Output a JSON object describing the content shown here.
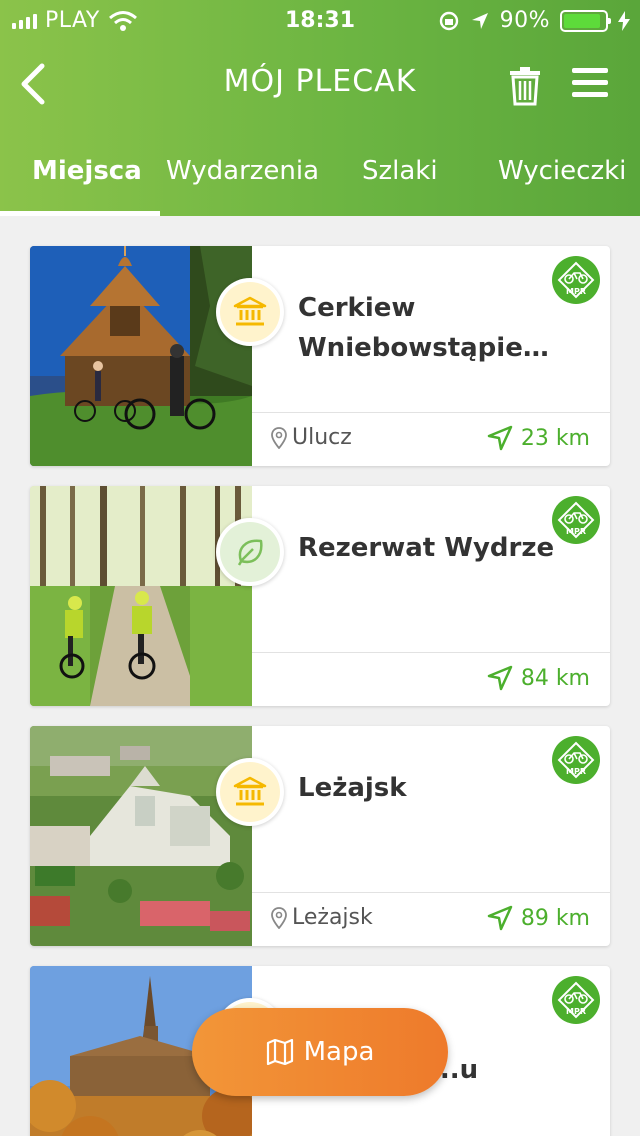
{
  "status_bar": {
    "carrier": "PLAY",
    "time": "18:31",
    "battery": "90%",
    "battery_level": 0.9
  },
  "nav": {
    "title": "MÓJ PLECAK"
  },
  "tabs": [
    {
      "label": "Miejsca",
      "active": true
    },
    {
      "label": "Wydarzenia",
      "active": false
    },
    {
      "label": "Szlaki",
      "active": false
    },
    {
      "label": "Wycieczki",
      "active": false
    }
  ],
  "cards": [
    {
      "title_line1": "Cerkiew",
      "title_line2": "Wniebowstąpieni...",
      "category_icon": "museum-icon",
      "location": "Ulucz",
      "distance": "23 km",
      "badge": "MPR"
    },
    {
      "title_line1": "Rezerwat Wydrze",
      "title_line2": "",
      "category_icon": "leaf-icon",
      "location": "",
      "distance": "84 km",
      "badge": "MPR"
    },
    {
      "title_line1": "Leżajsk",
      "title_line2": "",
      "category_icon": "museum-icon",
      "location": "Leżajsk",
      "distance": "89 km",
      "badge": "MPR"
    },
    {
      "title_line1": "...u",
      "title_line2": "",
      "category_icon": "museum-icon",
      "location": "",
      "distance": "",
      "badge": "MPR"
    }
  ],
  "map_button": {
    "label": "Mapa"
  },
  "colors": {
    "accent_green": "#6cb542",
    "distance_green": "#4caf2d",
    "orange": "#f08a32",
    "museum_yellow": "#f5b800",
    "leaf_green": "#7cbf5a"
  }
}
